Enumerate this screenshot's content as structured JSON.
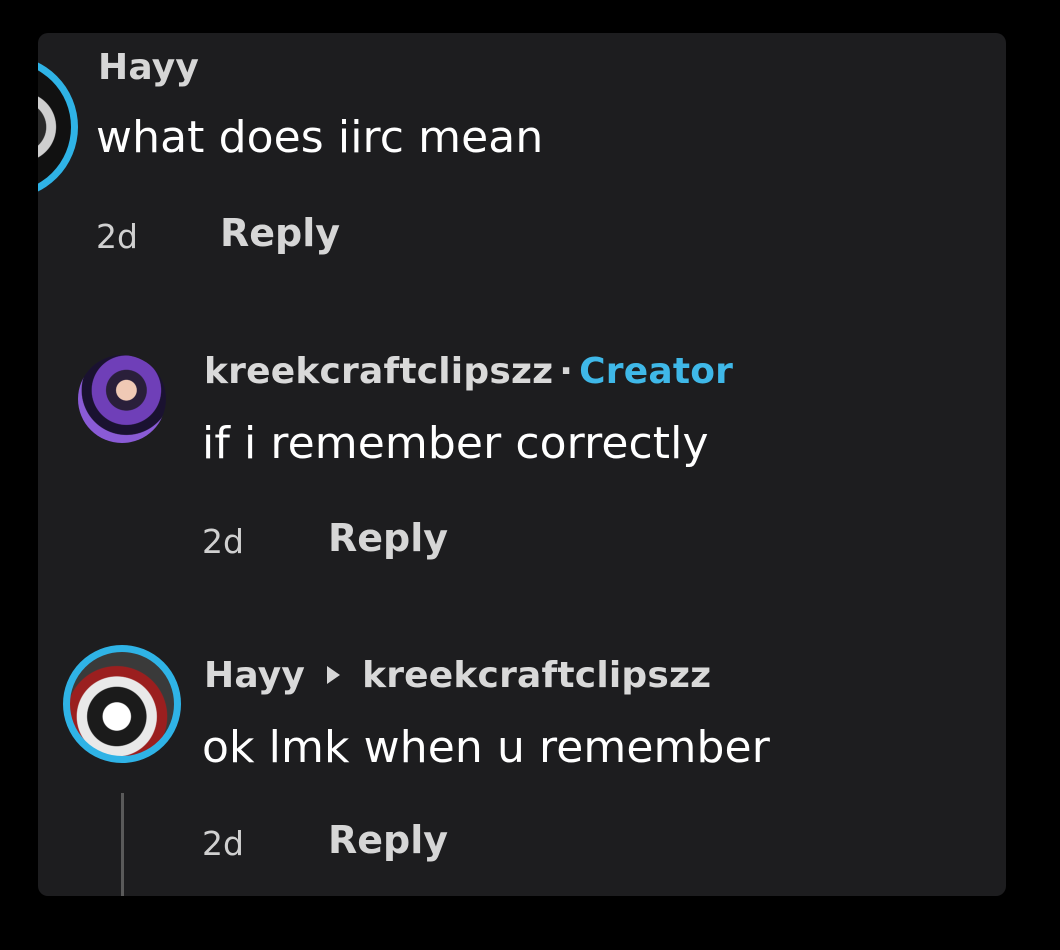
{
  "comments": [
    {
      "username": "Hayy",
      "text": "what does iirc mean",
      "time": "2d",
      "reply_label": "Reply"
    },
    {
      "username": "kreekcraftclipszz",
      "separator": "·",
      "badge": "Creator",
      "text": "if i remember correctly",
      "time": "2d",
      "reply_label": "Reply"
    },
    {
      "username": "Hayy",
      "reply_to": "kreekcraftclipszz",
      "text": "ok lmk when u remember",
      "time": "2d",
      "reply_label": "Reply"
    }
  ],
  "colors": {
    "background": "#000000",
    "panel": "#1d1d1f",
    "creator_badge": "#3fb8e8",
    "avatar_ring": "#2fb3e6"
  },
  "icons": {
    "reply_arrow": "triangle-right-icon"
  }
}
